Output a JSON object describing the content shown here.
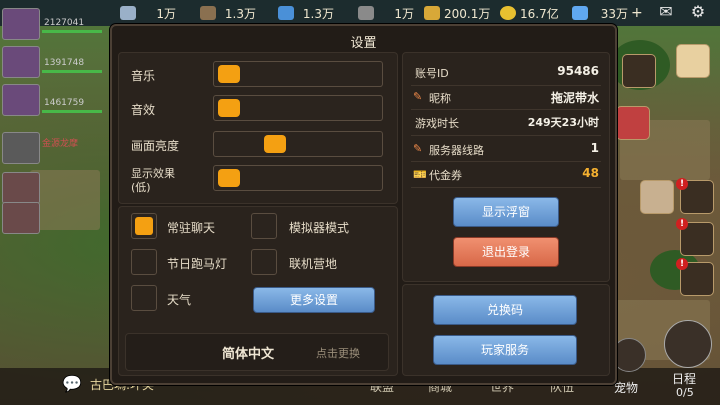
{
  "resources": [
    {
      "icon": "silver-icon",
      "value": "1万"
    },
    {
      "icon": "wood-icon",
      "value": "1.3万"
    },
    {
      "icon": "crystal-icon",
      "value": "1.3万"
    },
    {
      "icon": "stone-icon",
      "value": "1万"
    },
    {
      "icon": "wheat-icon",
      "value": "200.1万"
    },
    {
      "icon": "gold-coin-icon",
      "value": "16.7亿"
    },
    {
      "icon": "diamond-icon",
      "value": "33万"
    }
  ],
  "roster": [
    {
      "power": "2127041"
    },
    {
      "power": "1391748"
    },
    {
      "power": "1461759"
    },
    {
      "name": "金源龙摩"
    }
  ],
  "dialog": {
    "title": "设置",
    "music_label": "音乐",
    "music_level": 0,
    "sfx_label": "音效",
    "sfx_level": 0,
    "brightness_label": "画面亮度",
    "brightness_level": 0.5,
    "display_label": "显示效果",
    "display_sub": "(低)",
    "display_level": 0,
    "options": [
      {
        "label": "常驻聊天",
        "checked": true
      },
      {
        "label": "模拟器模式",
        "checked": false
      },
      {
        "label": "节日跑马灯",
        "checked": false
      },
      {
        "label": "联机营地",
        "checked": false
      },
      {
        "label": "天气",
        "checked": false
      }
    ],
    "more_settings": "更多设置",
    "language": "简体中文",
    "language_change": "点击更换",
    "account": {
      "id_label": "账号ID",
      "id_value": "95486",
      "nick_label": "昵称",
      "nick_value": "拖泥带水",
      "time_label": "游戏时长",
      "time_value": "249天23小时",
      "server_label": "服务器线路",
      "server_value": "1",
      "voucher_label": "代金券",
      "voucher_value": "48"
    },
    "show_float": "显示浮窗",
    "logout": "退出登录",
    "redeem": "兑换码",
    "player_service": "玩家服务"
  },
  "bottom": {
    "chat": "古巴瑪:坏笑",
    "nav": [
      "联盟",
      "商城",
      "世界",
      "队伍"
    ],
    "pet": "宠物",
    "schedule": "日程",
    "schedule_count": "0/5"
  },
  "colors": {
    "accent": "#f4a012",
    "blue_button": "#6a9ad8",
    "red_button": "#e07858",
    "voucher": "#f4b030"
  }
}
